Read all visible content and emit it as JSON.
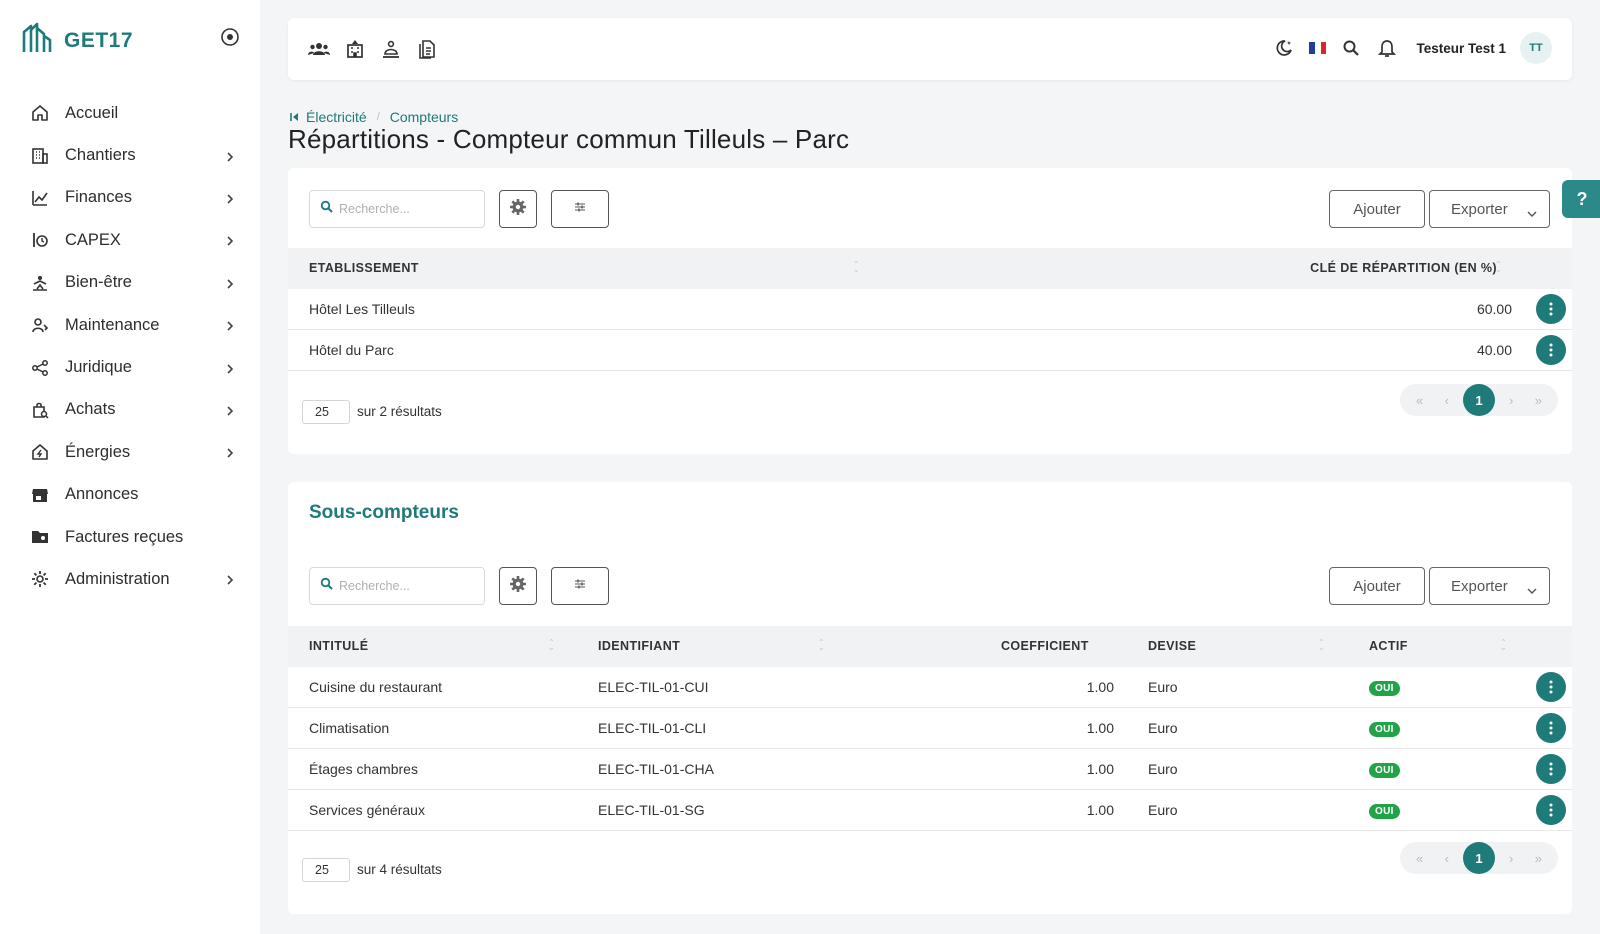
{
  "brand": {
    "name": "GET17"
  },
  "sidebar": {
    "items": [
      {
        "label": "Accueil",
        "icon": "home-icon",
        "chevron": false
      },
      {
        "label": "Chantiers",
        "icon": "building-icon",
        "chevron": true
      },
      {
        "label": "Finances",
        "icon": "finance-chart-icon",
        "chevron": true
      },
      {
        "label": "CAPEX",
        "icon": "capex-icon",
        "chevron": true
      },
      {
        "label": "Bien-être",
        "icon": "wellbeing-icon",
        "chevron": true
      },
      {
        "label": "Maintenance",
        "icon": "maintenance-icon",
        "chevron": true
      },
      {
        "label": "Juridique",
        "icon": "share-icon",
        "chevron": true
      },
      {
        "label": "Achats",
        "icon": "shopping-bag-icon",
        "chevron": true
      },
      {
        "label": "Énergies",
        "icon": "energy-home-icon",
        "chevron": true
      },
      {
        "label": "Annonces",
        "icon": "store-icon",
        "chevron": false
      },
      {
        "label": "Factures reçues",
        "icon": "folder-icon",
        "chevron": false
      },
      {
        "label": "Administration",
        "icon": "gear-icon",
        "chevron": true
      }
    ]
  },
  "topbar": {
    "user_name": "Testeur Test 1",
    "avatar_initials": "TT"
  },
  "breadcrumb": {
    "parent": "Électricité",
    "current": "Compteurs"
  },
  "page": {
    "title": "Répartitions - Compteur commun Tilleuls – Parc"
  },
  "repartitions": {
    "search_placeholder": "Recherche...",
    "add_label": "Ajouter",
    "export_label": "Exporter",
    "columns": [
      "ETABLISSEMENT",
      "CLÉ DE RÉPARTITION (EN %)"
    ],
    "rows": [
      {
        "etablissement": "Hôtel Les Tilleuls",
        "cle": "60.00"
      },
      {
        "etablissement": "Hôtel du Parc",
        "cle": "40.00"
      }
    ],
    "page_size": "25",
    "results_text": "sur 2 résultats",
    "pager": {
      "first": "«",
      "prev": "‹",
      "current": "1",
      "next": "›",
      "last": "»"
    }
  },
  "sous_compteurs": {
    "title": "Sous-compteurs",
    "search_placeholder": "Recherche...",
    "add_label": "Ajouter",
    "export_label": "Exporter",
    "columns": [
      "INTITULÉ",
      "IDENTIFIANT",
      "COEFFICIENT",
      "DEVISE",
      "ACTIF"
    ],
    "rows": [
      {
        "intitule": "Cuisine du restaurant",
        "identifiant": "ELEC-TIL-01-CUI",
        "coefficient": "1.00",
        "devise": "Euro",
        "actif": "OUI"
      },
      {
        "intitule": "Climatisation",
        "identifiant": "ELEC-TIL-01-CLI",
        "coefficient": "1.00",
        "devise": "Euro",
        "actif": "OUI"
      },
      {
        "intitule": "Étages chambres",
        "identifiant": "ELEC-TIL-01-CHA",
        "coefficient": "1.00",
        "devise": "Euro",
        "actif": "OUI"
      },
      {
        "intitule": "Services généraux",
        "identifiant": "ELEC-TIL-01-SG",
        "coefficient": "1.00",
        "devise": "Euro",
        "actif": "OUI"
      }
    ],
    "page_size": "25",
    "results_text": "sur 4 résultats",
    "pager": {
      "first": "«",
      "prev": "‹",
      "current": "1",
      "next": "›",
      "last": "»"
    }
  },
  "help": {
    "label": "?"
  },
  "colors": {
    "accent": "#1f7a7a",
    "active_badge": "#22a34a"
  }
}
